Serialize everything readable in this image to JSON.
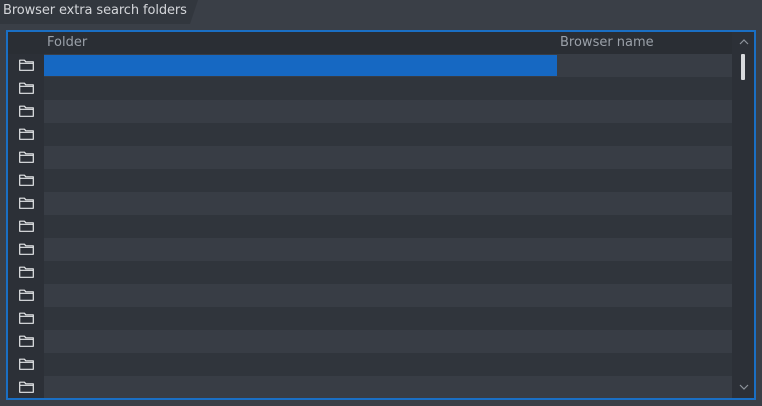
{
  "tab": {
    "title": "Browser extra search folders"
  },
  "table": {
    "columns": {
      "folder": "Folder",
      "browser_name": "Browser name"
    },
    "selected_row": 0,
    "rows": [
      {
        "folder": "",
        "browser_name": ""
      },
      {
        "folder": "",
        "browser_name": ""
      },
      {
        "folder": "",
        "browser_name": ""
      },
      {
        "folder": "",
        "browser_name": ""
      },
      {
        "folder": "",
        "browser_name": ""
      },
      {
        "folder": "",
        "browser_name": ""
      },
      {
        "folder": "",
        "browser_name": ""
      },
      {
        "folder": "",
        "browser_name": ""
      },
      {
        "folder": "",
        "browser_name": ""
      },
      {
        "folder": "",
        "browser_name": ""
      },
      {
        "folder": "",
        "browser_name": ""
      },
      {
        "folder": "",
        "browser_name": ""
      },
      {
        "folder": "",
        "browser_name": ""
      },
      {
        "folder": "",
        "browser_name": ""
      },
      {
        "folder": "",
        "browser_name": ""
      }
    ],
    "row_icon": "folder-icon"
  },
  "colors": {
    "accent": "#1a6fc4",
    "selection": "#1668c2",
    "background": "#3a3f47"
  }
}
